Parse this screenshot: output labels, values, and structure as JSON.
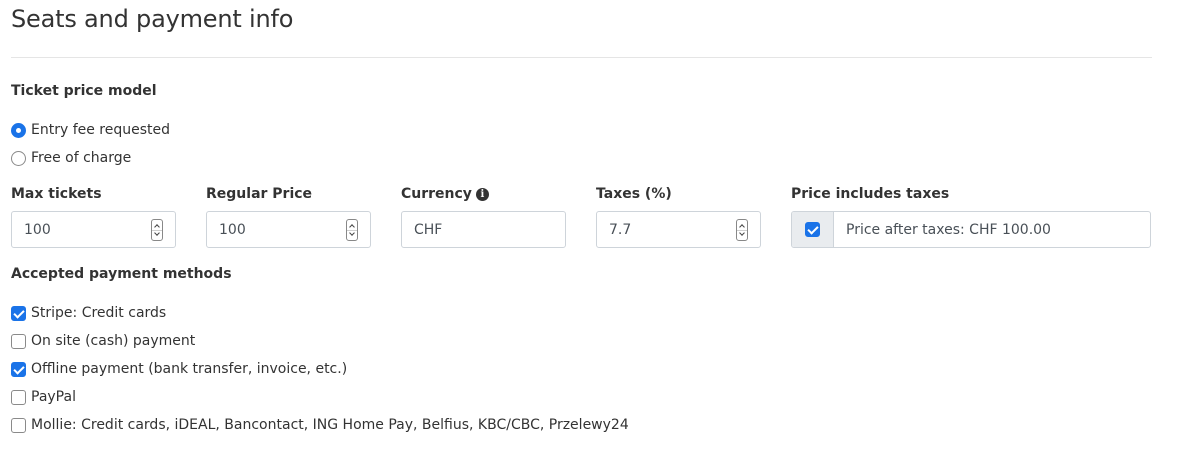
{
  "section": {
    "title": "Seats and payment info"
  },
  "price_model": {
    "label": "Ticket price model",
    "options": [
      {
        "label": "Entry fee requested",
        "checked": true
      },
      {
        "label": "Free of charge",
        "checked": false
      }
    ]
  },
  "fields": {
    "max_tickets": {
      "label": "Max tickets",
      "value": "100"
    },
    "regular_price": {
      "label": "Regular Price",
      "value": "100"
    },
    "currency": {
      "label": "Currency",
      "value": "CHF",
      "icon": "info-icon"
    },
    "taxes": {
      "label": "Taxes (%)",
      "value": "7.7"
    },
    "price_includes_taxes": {
      "label": "Price includes taxes",
      "checked": true,
      "text": "Price after taxes: CHF 100.00"
    }
  },
  "payment_methods": {
    "label": "Accepted payment methods",
    "items": [
      {
        "label": "Stripe: Credit cards",
        "checked": true
      },
      {
        "label": "On site (cash) payment",
        "checked": false
      },
      {
        "label": "Offline payment (bank transfer, invoice, etc.)",
        "checked": true
      },
      {
        "label": "PayPal",
        "checked": false
      },
      {
        "label": "Mollie: Credit cards, iDEAL, Bancontact, ING Home Pay, Belfius, KBC/CBC, Przelewy24",
        "checked": false
      }
    ]
  },
  "colors": {
    "accent": "#1a73e8",
    "text": "#333333",
    "border": "#ced4da",
    "addon_bg": "#e9ecef"
  }
}
